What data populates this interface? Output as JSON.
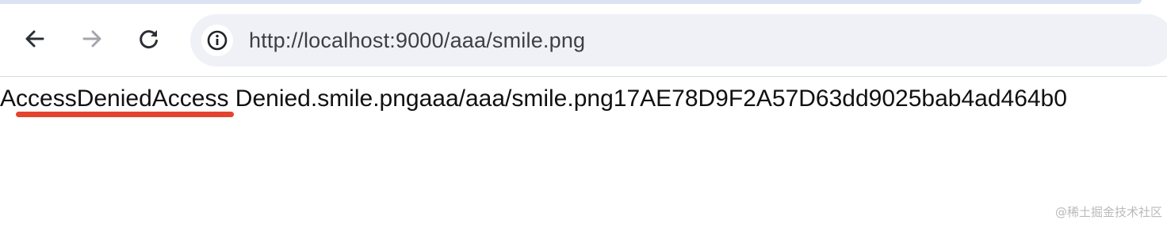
{
  "browser": {
    "url": "http://localhost:9000/aaa/smile.png",
    "accent_color": "#dbe3f2",
    "icons": {
      "back": "arrow-left-icon",
      "forward": "arrow-right-icon",
      "reload": "reload-icon",
      "site_info": "info-icon"
    }
  },
  "page": {
    "content_text": "AccessDeniedAccess Denied.smile.pngaaa/aaa/smile.png17AE78D9F2A57D63dd9025bab4ad464b0",
    "highlight_color": "#e4432d"
  },
  "watermark": {
    "text": "@稀土掘金技术社区"
  }
}
